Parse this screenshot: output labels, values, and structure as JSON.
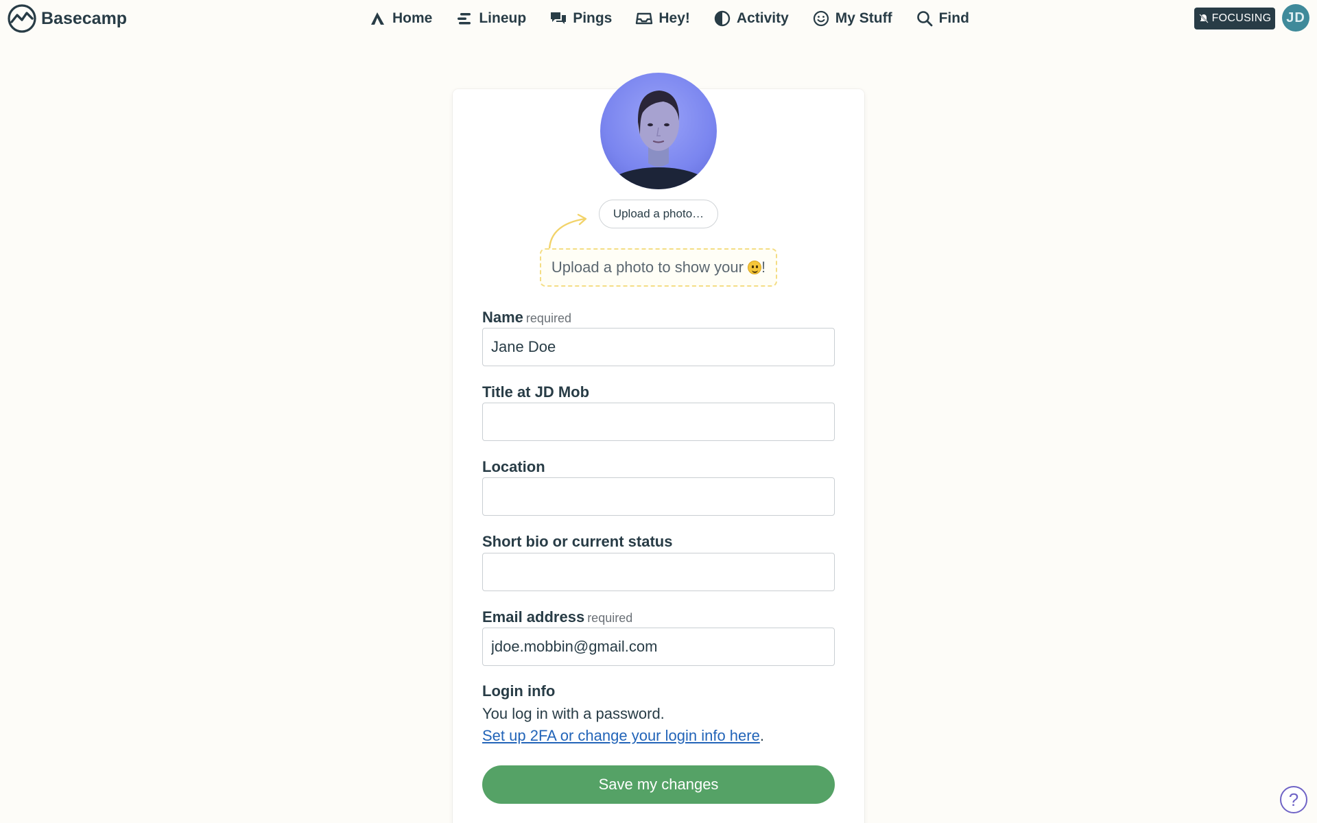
{
  "app": {
    "name": "Basecamp"
  },
  "nav": {
    "items": [
      {
        "label": "Home",
        "icon": "home-icon"
      },
      {
        "label": "Lineup",
        "icon": "lineup-icon"
      },
      {
        "label": "Pings",
        "icon": "pings-icon"
      },
      {
        "label": "Hey!",
        "icon": "inbox-icon"
      },
      {
        "label": "Activity",
        "icon": "activity-icon"
      },
      {
        "label": "My Stuff",
        "icon": "smiley-icon"
      },
      {
        "label": "Find",
        "icon": "search-icon"
      }
    ],
    "focusing_label": "FOCUSING",
    "user_initials": "JD"
  },
  "profile": {
    "upload_button": "Upload a photo…",
    "upload_hint": "Upload a photo to show your",
    "upload_hint_suffix": "!"
  },
  "form": {
    "name": {
      "label": "Name",
      "required": "required",
      "value": "Jane Doe"
    },
    "title": {
      "label": "Title at JD Mob",
      "value": ""
    },
    "location": {
      "label": "Location",
      "value": ""
    },
    "bio": {
      "label": "Short bio or current status",
      "value": ""
    },
    "email": {
      "label": "Email address",
      "required": "required",
      "value": "jdoe.mobbin@gmail.com"
    }
  },
  "login": {
    "title": "Login info",
    "text": "You log in with a password.",
    "link": "Set up 2FA or change your login info here",
    "link_suffix": "."
  },
  "actions": {
    "save": "Save my changes"
  },
  "help": {
    "label": "?"
  },
  "colors": {
    "background": "#fdfcf8",
    "text": "#283c46",
    "save_button": "#55a266",
    "link": "#2264b8",
    "hint_border": "#f4dd84",
    "avatar": "#3f8a9a"
  }
}
